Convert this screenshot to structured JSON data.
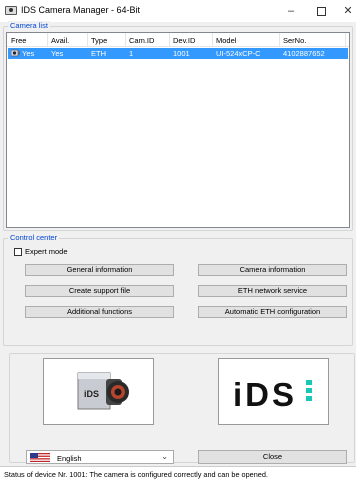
{
  "window": {
    "title": "IDS Camera Manager - 64-Bit",
    "minimize": "–",
    "close": "✕"
  },
  "camera_list": {
    "title": "Camera list",
    "columns": [
      "Free",
      "Avail.",
      "Type",
      "Cam.ID",
      "Dev.ID",
      "Model",
      "SerNo."
    ],
    "rows": [
      {
        "free": "Yes",
        "avail": "Yes",
        "type": "ETH",
        "cam_id": "1",
        "dev_id": "1001",
        "model": "UI-524xCP-C",
        "serno": "4102887652",
        "selected": true
      }
    ]
  },
  "control_center": {
    "title": "Control center",
    "expert_mode": {
      "label": "Expert mode",
      "checked": false
    },
    "buttons": {
      "general_info": "General information",
      "camera_info": "Camera information",
      "create_support": "Create support file",
      "eth_network": "ETH network service",
      "additional": "Additional functions",
      "auto_eth": "Automatic ETH configuration"
    }
  },
  "bottom": {
    "logo_text": "iDS",
    "language": "English",
    "close_button": "Close"
  },
  "status": {
    "text": "Status of device Nr. 1001: The camera is configured correctly and can be opened."
  },
  "colors": {
    "selection": "#3399ff",
    "group_title": "#0046d5",
    "logo_accent": "#18c8b4"
  }
}
